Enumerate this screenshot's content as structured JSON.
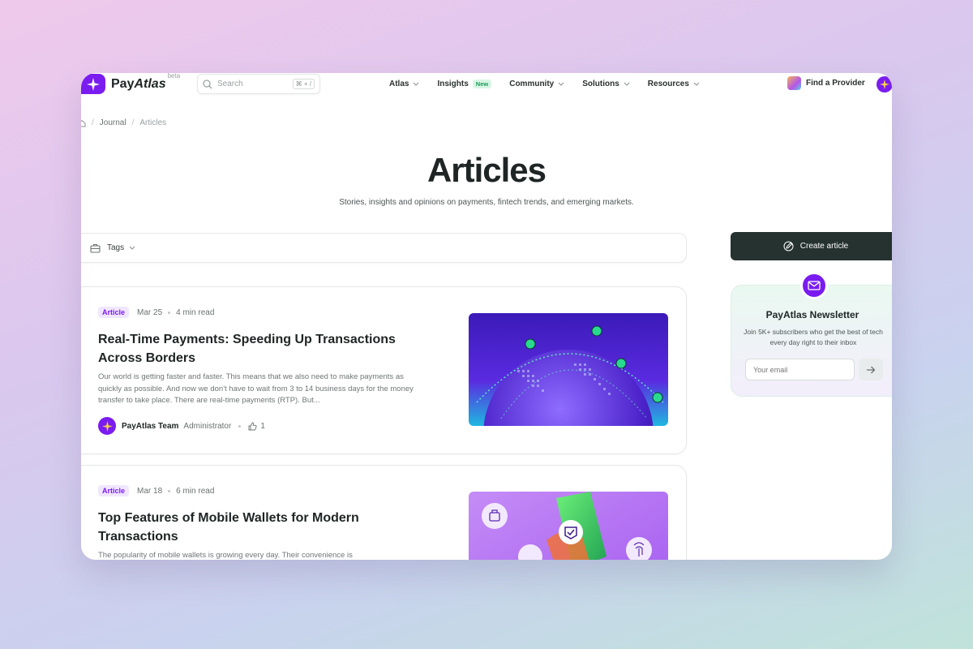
{
  "header": {
    "logo": {
      "brand_plain": "Pay",
      "brand_italic": "Atlas",
      "beta": "beta"
    },
    "search": {
      "placeholder": "Search",
      "shortcut": "⌘ + /"
    },
    "menu": [
      {
        "label": "Atlas",
        "has_dropdown": true
      },
      {
        "label": "Insights",
        "badge": "New",
        "has_dropdown": false
      },
      {
        "label": "Community",
        "has_dropdown": true
      },
      {
        "label": "Solutions",
        "has_dropdown": true
      },
      {
        "label": "Resources",
        "has_dropdown": true
      }
    ],
    "find_provider": "Find a Provider"
  },
  "breadcrumb": {
    "items": [
      "Journal",
      "Articles"
    ],
    "separator": "/"
  },
  "page": {
    "title": "Articles",
    "subtitle": "Stories, insights and opinions on payments, fintech trends, and emerging markets."
  },
  "filter": {
    "tags_label": "Tags"
  },
  "articles": [
    {
      "tag": "Article",
      "date": "Mar 25",
      "read_time": "4 min read",
      "title": "Real-Time Payments: Speeding Up Transactions Across Borders",
      "excerpt": "Our world is getting faster and faster. This means that we also need to make payments as quickly as possible. And now we don't have to wait from 3 to 14 business days for the money transfer to take place. There are real-time payments (RTP). But...",
      "author": "PayAtlas Team",
      "role": "Administrator",
      "likes": "1"
    },
    {
      "tag": "Article",
      "date": "Mar 18",
      "read_time": "6 min read",
      "title": "Top Features of Mobile Wallets for Modern Transactions",
      "excerpt": "The popularity of mobile wallets is growing every day. Their convenience is"
    }
  ],
  "sidebar": {
    "create_article": "Create article",
    "newsletter": {
      "title": "PayAtlas Newsletter",
      "description": "Join 5K+ subscribers who get the best of tech every day right to their inbox",
      "email_placeholder": "Your email"
    }
  },
  "colors": {
    "brand": "#7a1cf0",
    "dark": "#253230",
    "new_badge": "#1b9a5a"
  }
}
